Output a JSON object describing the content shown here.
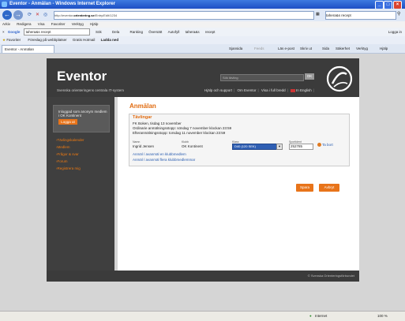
{
  "window": {
    "title": "Eventor - Anmälan - Windows Internet Explorer",
    "minimize": "_",
    "maximize": "□",
    "close": "×"
  },
  "address": {
    "url_prefix": "http://eventor.",
    "url_domain": "orientering.se",
    "url_path": "/Entry/Edit/1234",
    "search_text": "tahera&s recept"
  },
  "menu": [
    "Arkiv",
    "Redigera",
    "Visa",
    "Favoriter",
    "Verktyg",
    "Hjälp"
  ],
  "google_bar": {
    "label": "Google",
    "query": "tahera&s recept",
    "items": [
      "Sök",
      "Dela",
      "Ranking",
      "Översätt",
      "Autofyll",
      "tahera&s",
      "recept"
    ],
    "login": "Logga in"
  },
  "favorites_bar": {
    "label": "Favoriter",
    "items": [
      "Föreslag på webbplatser",
      "Gratis Hotmail",
      "Ladda ned"
    ]
  },
  "tab": {
    "title": "Eventor - Anmälan",
    "tools": [
      "Sjansida",
      "Feeds",
      "Läs e-post",
      "Skriv ut",
      "Sida",
      "Säkerhet",
      "Verktyg",
      "Hjälp"
    ]
  },
  "site": {
    "logo": "Eventor",
    "tagline": "Svenska orienteringens centrala IT-system",
    "search_placeholder": "Sök tävling",
    "search_button": "OK",
    "nav": [
      "Hjälp och support",
      "Om Eventor",
      "Visa i full bredd",
      "In English"
    ]
  },
  "sidebar": {
    "login_text": "Inloggad som anonym medlem i OK Kontinent",
    "login_button": "Logga ut",
    "links": [
      "Tävlingskalender",
      "Medlem",
      "Frågor & svar",
      "Forum",
      "Registrera mig"
    ]
  },
  "entry": {
    "heading": "Anmälan",
    "section_title": "Tävlingar",
    "event_line": "FK Boken, tisdag 13 november",
    "deadline_line": "Ordinarie anmälningsstopp: söndag 7 november klockan 23:59",
    "late_deadline_line": "Efteranmälningsstopp: torsdag 11 november klockan 23:59",
    "columns": {
      "name": "Namn",
      "club": "Klubb",
      "class": "Klass",
      "card": "Sportident"
    },
    "row": {
      "name": "Ingrid Jensen",
      "club": "OK Kontinent",
      "class": "D40 (120 SEK)",
      "card": "252785",
      "remove": "Ta bort"
    },
    "add_links": [
      "Anmäl / avanmäl en klubbmedlem",
      "Anmäl / avanmäl flera klubbmedlemmar"
    ],
    "save_button": "Spara",
    "cancel_button": "Avbryt"
  },
  "footer": {
    "text": "© Svenska Orienteringsförbundet"
  },
  "statusbar": {
    "zone": "Internet",
    "zoom": "100 %"
  },
  "colors": {
    "accent": "#e8741a",
    "header": "#3b3b3b",
    "select": "#2f5fb3"
  }
}
